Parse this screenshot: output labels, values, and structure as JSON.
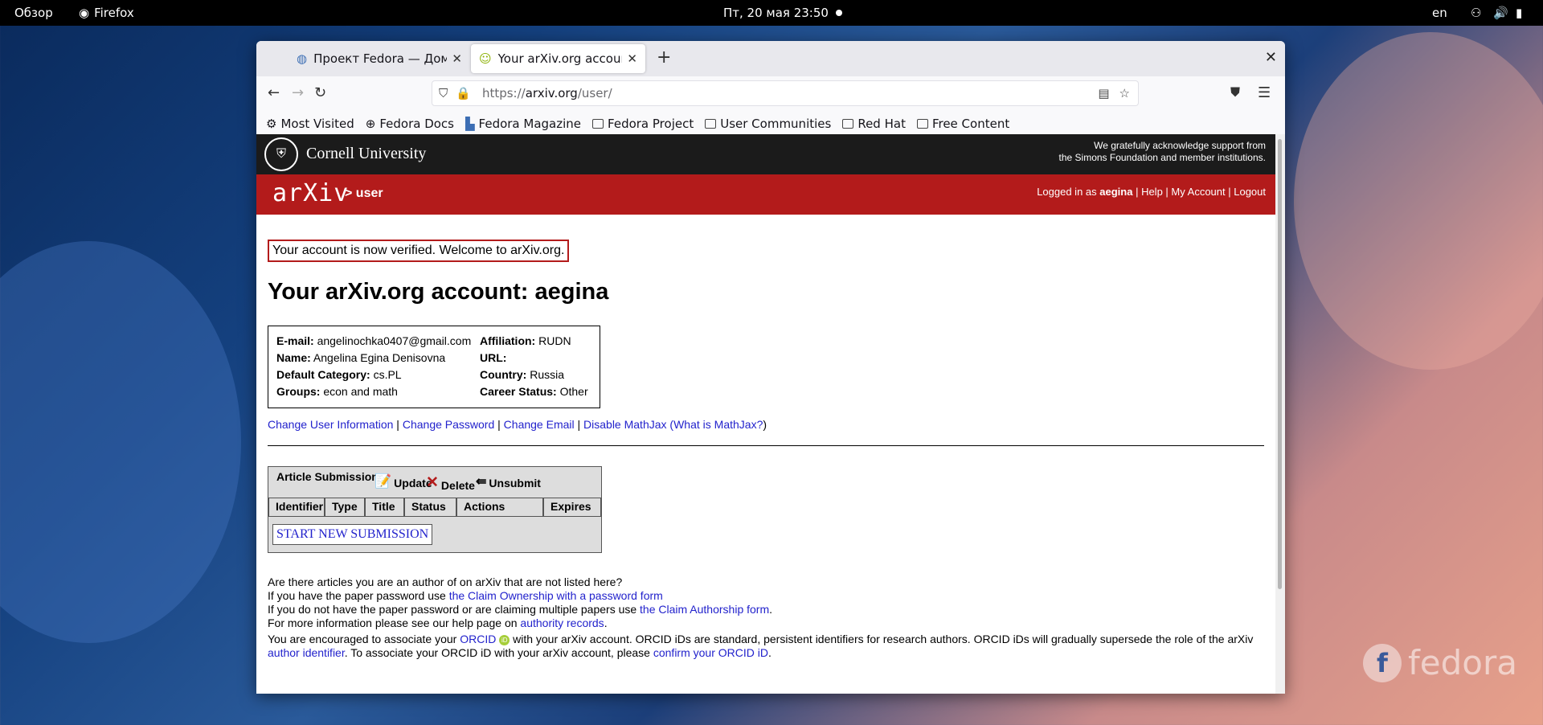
{
  "topbar": {
    "overview": "Обзор",
    "app_name": "Firefox",
    "clock": "Пт, 20 мая  23:50",
    "lang": "en"
  },
  "browser": {
    "tabs": [
      {
        "title": "Проект Fedora — Домашняя",
        "active": false
      },
      {
        "title": "Your arXiv.org account",
        "active": true
      }
    ],
    "url_scheme": "https://",
    "url_host": "arxiv.org",
    "url_path": "/user/",
    "bookmarks": [
      "Most Visited",
      "Fedora Docs",
      "Fedora Magazine",
      "Fedora Project",
      "User Communities",
      "Red Hat",
      "Free Content"
    ]
  },
  "cornell": {
    "name": "Cornell University",
    "ack_line1": "We gratefully acknowledge support from",
    "ack_line2": "the Simons Foundation and member institutions."
  },
  "arxiv": {
    "logo": "arXiv",
    "crumb": "> user",
    "logged_prefix": "Logged in as",
    "username": "aegina",
    "help": "Help",
    "my_account": "My Account",
    "logout": "Logout"
  },
  "main": {
    "verified_msg": "Your account is now verified. Welcome to arXiv.org.",
    "heading": "Your arXiv.org account: aegina",
    "info": {
      "email_label": "E-mail:",
      "email": "angelinochka0407@gmail.com",
      "name_label": "Name:",
      "name": "Angelina Egina Denisovna",
      "category_label": "Default Category:",
      "category": "cs.PL",
      "groups_label": "Groups:",
      "groups": "econ and math",
      "affiliation_label": "Affiliation:",
      "affiliation": "RUDN",
      "url_label": "URL:",
      "url": "",
      "country_label": "Country:",
      "country": "Russia",
      "career_label": "Career Status:",
      "career": "Other"
    },
    "links": {
      "change_info": "Change User Information",
      "change_password": "Change Password",
      "change_email": "Change Email",
      "disable_mathjax": "Disable MathJax",
      "what_is_mathjax": "What is MathJax?"
    },
    "submissions": {
      "title": "Article Submissions",
      "update": "Update",
      "delete": "Delete",
      "unsubmit": "Unsubmit",
      "columns": [
        "Identifier",
        "Type",
        "Title",
        "Status",
        "Actions",
        "Expires"
      ],
      "start_new": "START NEW SUBMISSION"
    },
    "claims": {
      "q": "Are there articles you are an author of on arXiv that are not listed here?",
      "l1_pre": "If you have the paper password use ",
      "l1_link": "the Claim Ownership with a password form",
      "l2_pre": "If you do not have the paper password or are claiming multiple papers use ",
      "l2_link": "the Claim Authorship form",
      "l2_post": ".",
      "l3_pre": "For more information please see our help page on ",
      "l3_link": "authority records",
      "l3_post": "."
    },
    "orcid": {
      "pre": "You are encouraged to associate your ",
      "link": "ORCID",
      "mid": " with your arXiv account. ORCID iDs are standard, persistent identifiers for research authors. ORCID iDs will gradually supersede the role of the arXiv ",
      "author_id": "author identifier",
      "mid2": ". To associate your ORCID iD with your arXiv account, please ",
      "confirm": "confirm your ORCID iD",
      "post": "."
    }
  },
  "desktop": {
    "brand": "fedora"
  }
}
